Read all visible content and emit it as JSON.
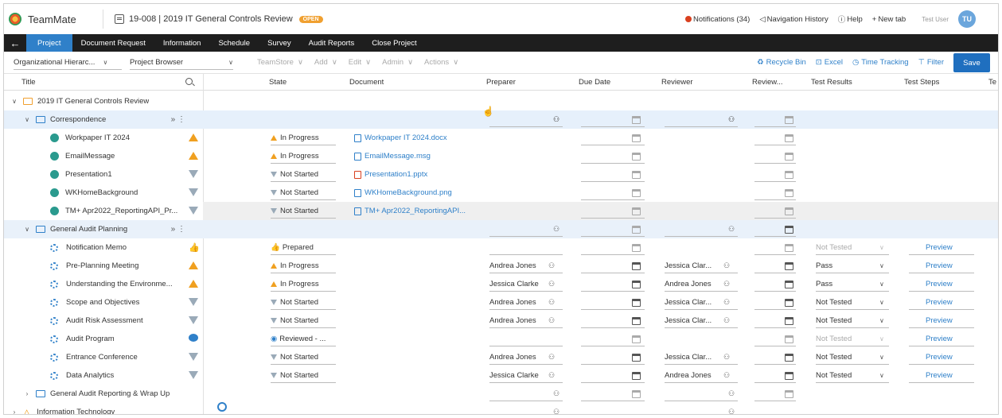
{
  "app": {
    "name": "TeamMate",
    "project_title": "19-008 | 2019 IT General Controls Review",
    "project_status": "OPEN"
  },
  "header_links": {
    "notifications": "Notifications (34)",
    "navigation_history": "Navigation History",
    "help": "Help",
    "new_tab": "New tab",
    "user_name": "Test User",
    "user_initials": "TU"
  },
  "nav": {
    "back": "←",
    "tabs": [
      "Project",
      "Document Request",
      "Information",
      "Schedule",
      "Survey",
      "Audit Reports",
      "Close Project"
    ]
  },
  "toolbar": {
    "hierarchy": "Organizational Hierarc...",
    "browser": "Project Browser",
    "menus": [
      "TeamStore",
      "Add",
      "Edit",
      "Admin",
      "Actions"
    ],
    "right": [
      "Recycle Bin",
      "Excel",
      "Time Tracking",
      "Filter"
    ],
    "save": "Save"
  },
  "columns": [
    "Title",
    "State",
    "Document",
    "Preparer",
    "Due Date",
    "Reviewer",
    "Review...",
    "Test Results",
    "Test Steps",
    "Te"
  ],
  "rows": [
    {
      "title": "2019 IT General Controls Review",
      "level": 0,
      "kind": "project",
      "caret": "v"
    },
    {
      "title": "Correspondence",
      "level": 1,
      "kind": "folder",
      "caret": "v",
      "selected": true
    },
    {
      "title": "Workpaper IT 2024",
      "level": 2,
      "kind": "doc",
      "status": "up",
      "state": "In Progress",
      "document": "Workpaper IT 2024.docx"
    },
    {
      "title": "EmailMessage",
      "level": 2,
      "kind": "doc",
      "status": "up",
      "state": "In Progress",
      "document": "EmailMessage.msg"
    },
    {
      "title": "Presentation1",
      "level": 2,
      "kind": "doc",
      "status": "down",
      "state": "Not Started",
      "document": "Presentation1.pptx"
    },
    {
      "title": "WKHomeBackground",
      "level": 2,
      "kind": "doc",
      "status": "down",
      "state": "Not Started",
      "document": "WKHomeBackground.png"
    },
    {
      "title": "TM+ Apr2022_ReportingAPI_Pr...",
      "level": 2,
      "kind": "doc",
      "status": "down",
      "state": "Not Started",
      "document": "TM+ Apr2022_ReportingAPI...",
      "hover": true
    },
    {
      "title": "General Audit Planning",
      "level": 1,
      "kind": "folder",
      "caret": "v",
      "hover": true
    },
    {
      "title": "Notification Memo",
      "level": 2,
      "kind": "proc",
      "status": "thumb",
      "state": "Prepared",
      "result": "Not Tested",
      "result_muted": true,
      "steps": "Preview"
    },
    {
      "title": "Pre-Planning Meeting",
      "level": 2,
      "kind": "proc",
      "status": "up",
      "state": "In Progress",
      "preparer": "Andrea Jones",
      "reviewer": "Jessica Clar...",
      "result": "Pass",
      "steps": "Preview"
    },
    {
      "title": "Understanding the Environme...",
      "level": 2,
      "kind": "proc",
      "status": "up",
      "state": "In Progress",
      "preparer": "Jessica Clarke",
      "reviewer": "Andrea Jones",
      "result": "Pass",
      "steps": "Preview"
    },
    {
      "title": "Scope and Objectives",
      "level": 2,
      "kind": "proc",
      "status": "down",
      "state": "Not Started",
      "preparer": "Andrea Jones",
      "reviewer": "Jessica Clar...",
      "result": "Not Tested",
      "steps": "Preview"
    },
    {
      "title": "Audit Risk Assessment",
      "level": 2,
      "kind": "proc",
      "status": "down",
      "state": "Not Started",
      "preparer": "Andrea Jones",
      "reviewer": "Jessica Clar...",
      "result": "Not Tested",
      "steps": "Preview"
    },
    {
      "title": "Audit Program",
      "level": 2,
      "kind": "proc",
      "status": "rev",
      "state": "Reviewed - ...",
      "result": "Not Tested",
      "result_muted": true,
      "steps": "Preview"
    },
    {
      "title": "Entrance Conference",
      "level": 2,
      "kind": "proc",
      "status": "down",
      "state": "Not Started",
      "preparer": "Andrea Jones",
      "reviewer": "Jessica Clar...",
      "result": "Not Tested",
      "steps": "Preview"
    },
    {
      "title": "Data Analytics",
      "level": 2,
      "kind": "proc",
      "status": "down",
      "state": "Not Started",
      "preparer": "Jessica Clarke",
      "reviewer": "Andrea Jones",
      "result": "Not Tested",
      "steps": "Preview"
    },
    {
      "title": "General Audit Reporting & Wrap Up",
      "level": 1,
      "kind": "folder",
      "caret": ">"
    },
    {
      "title": "Information Technology",
      "level": 0,
      "kind": "warn-folder",
      "caret": ">"
    }
  ]
}
